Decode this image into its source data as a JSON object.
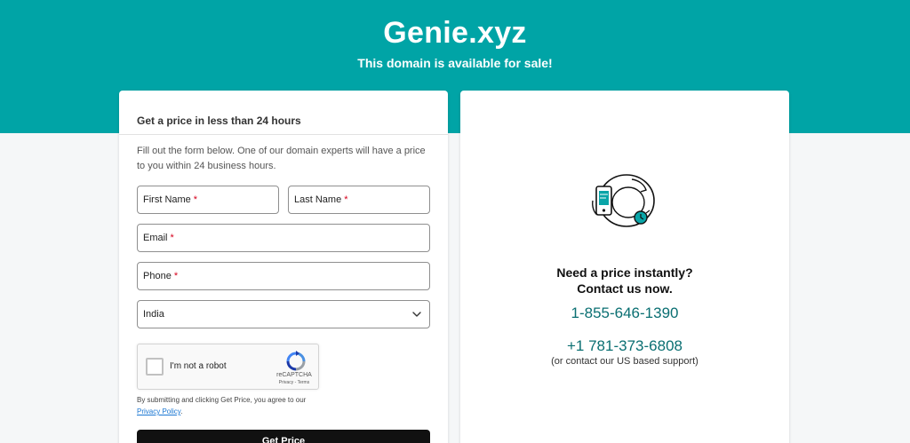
{
  "header": {
    "domain": "Genie.xyz",
    "tagline": "This domain is available for sale!"
  },
  "form": {
    "title": "Get a price in less than 24 hours",
    "description": "Fill out the form below. One of our domain experts will have a price to you within 24 business hours.",
    "first_name_placeholder": "First Name",
    "last_name_placeholder": "Last Name",
    "email_placeholder": "Email",
    "phone_placeholder": "Phone",
    "required_marker": "*",
    "country_value": "India",
    "captcha": {
      "label": "I'm not a robot",
      "brand": "reCAPTCHA",
      "privacy": "Privacy",
      "separator": "-",
      "terms": "Terms"
    },
    "consent_text": "By submitting and clicking Get Price, you agree to our",
    "privacy_link": "Privacy Policy",
    "consent_end": ".",
    "submit_label": "Get Price"
  },
  "contact": {
    "heading_line1": "Need a price instantly?",
    "heading_line2": "Contact us now.",
    "phone_primary": "1-855-646-1390",
    "phone_secondary": "+1 781-373-6808",
    "support_note": "(or contact our US based support)"
  },
  "colors": {
    "banner": "#00a4a6",
    "phone_link": "#0a6f72",
    "button": "#111111",
    "required": "#d6001c"
  },
  "icons": {
    "select_arrow": "chevron-down-icon",
    "recaptcha": "recaptcha-logo-icon",
    "illustration": "phone-clock-illustration"
  }
}
